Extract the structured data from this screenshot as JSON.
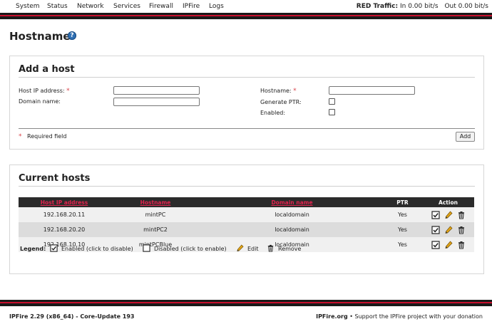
{
  "nav": {
    "items": [
      "System",
      "Status",
      "Network",
      "Services",
      "Firewall",
      "IPFire",
      "Logs"
    ],
    "traffic_label": "RED Traffic:",
    "traffic_in": "In 0.00 bit/s",
    "traffic_out": "Out 0.00 bit/s"
  },
  "page": {
    "title": "Hostname",
    "help_glyph": "?"
  },
  "add_host": {
    "title": "Add a host",
    "ip_label": "Host IP address:",
    "domain_label": "Domain name:",
    "hostname_label": "Hostname:",
    "ptr_label": "Generate PTR:",
    "enabled_label": "Enabled:",
    "required_marker": "*",
    "required_text": "Required field",
    "add_button": "Add",
    "ip_value": "",
    "domain_value": "",
    "hostname_value": ""
  },
  "current_hosts": {
    "title": "Current hosts",
    "columns": [
      "Host IP address",
      "Hostname",
      "Domain name",
      "PTR",
      "Action"
    ],
    "rows": [
      {
        "ip": "192.168.20.11",
        "hostname": "mintPC",
        "domain": "localdomain",
        "ptr": "Yes"
      },
      {
        "ip": "192.168.20.20",
        "hostname": "mintPC2",
        "domain": "localdomain",
        "ptr": "Yes"
      },
      {
        "ip": "192.168.10.10",
        "hostname": "mintPCBlue",
        "domain": "localdomain",
        "ptr": "Yes"
      }
    ],
    "legend": {
      "label": "Legend:",
      "enabled": "Enabled (click to disable)",
      "disabled": "Disabled (click to enable)",
      "edit": "Edit",
      "remove": "Remove"
    }
  },
  "footer": {
    "version": "IPFire 2.29 (x86_64) - Core-Update 193",
    "site": "IPFire.org",
    "support": "• Support the IPFire project with your donation"
  },
  "colors": {
    "accent_red": "#c8102e",
    "band_dark": "#1a1a1a",
    "sort_link": "#e0234e",
    "required": "#d9434a",
    "help_blue": "#2f6fb3",
    "pencil": "#e2a516"
  }
}
